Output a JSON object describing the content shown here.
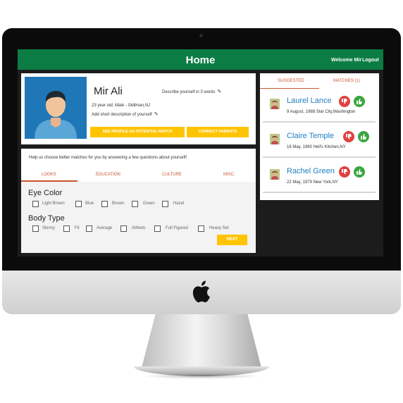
{
  "header": {
    "title": "Home",
    "welcome": "Welcome Mir",
    "logout": "Logout"
  },
  "profile": {
    "name": "Mir Ali",
    "details": "23 year old, Male - Skillman,NJ",
    "add_description": "Add short description of yourself",
    "describe_prompt": "Describe yourself in 3 words",
    "see_profile_button": "SEE PROFILE AS POTENTIAL MATCH",
    "connect_parents_button": "CONNECT PARENTS"
  },
  "quiz": {
    "hint": "Help us choose better matches for you by answering a few questions about yourself!",
    "tabs": [
      "LOOKS",
      "EDUCATION",
      "CULTURE",
      "MISC."
    ],
    "eye_color": {
      "title": "Eye Color",
      "options": [
        "Light Brown",
        "Blue",
        "Brown",
        "Green",
        "Hazel"
      ]
    },
    "body_type": {
      "title": "Body Type",
      "options": [
        "Skinny",
        "Fit",
        "Average",
        "Athletic",
        "Full Figured",
        "Heavy Set"
      ]
    },
    "next_button": "NEXT"
  },
  "matches": {
    "tabs": [
      "SUGGESTED",
      "MATCHES (1)"
    ],
    "items": [
      {
        "name": "Laurel Lance",
        "info": "9 August, 1988 Star City,Washington"
      },
      {
        "name": "Claire Temple",
        "info": "16 May, 1980 Hell's Kitchen,NY"
      },
      {
        "name": "Rachel Green",
        "info": "22 May, 1979 New York,NY"
      }
    ]
  },
  "colors": {
    "header_green": "#0b7d44",
    "button_yellow": "#ffc400",
    "tab_accent": "#c9542e",
    "match_name_blue": "#1f7fc4",
    "dislike_red": "#e04040",
    "like_green": "#3aa640"
  }
}
